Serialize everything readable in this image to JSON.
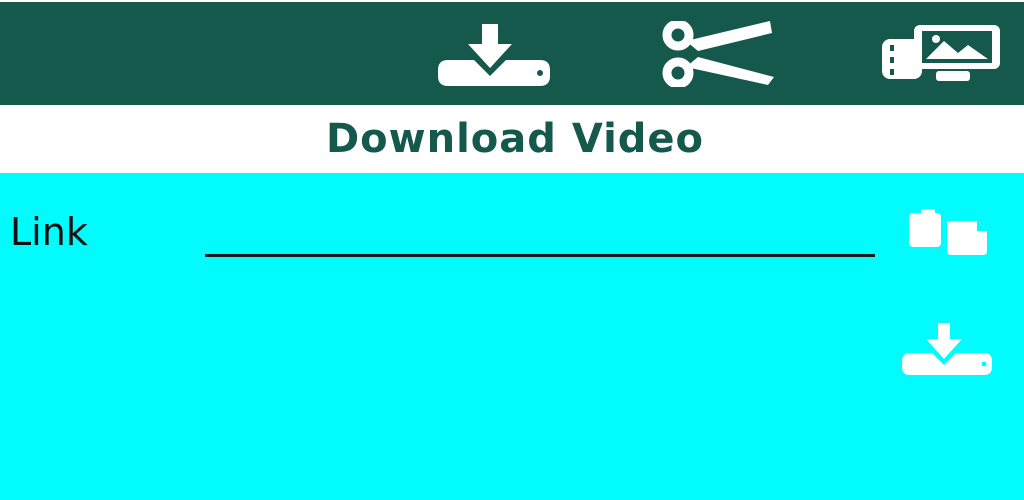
{
  "toolbar": {
    "background": "#14594b",
    "icon_color": "#ffffff",
    "buttons": [
      {
        "icon": "download-icon"
      },
      {
        "icon": "scissors-icon"
      },
      {
        "icon": "gallery-icon"
      }
    ]
  },
  "header": {
    "title": "Download Video",
    "title_color": "#14594b"
  },
  "form": {
    "background": "#00fcfc",
    "link_label": "Link",
    "link_value": "",
    "link_placeholder": "",
    "paste_icon": "paste-icon",
    "download_icon": "download-icon"
  }
}
